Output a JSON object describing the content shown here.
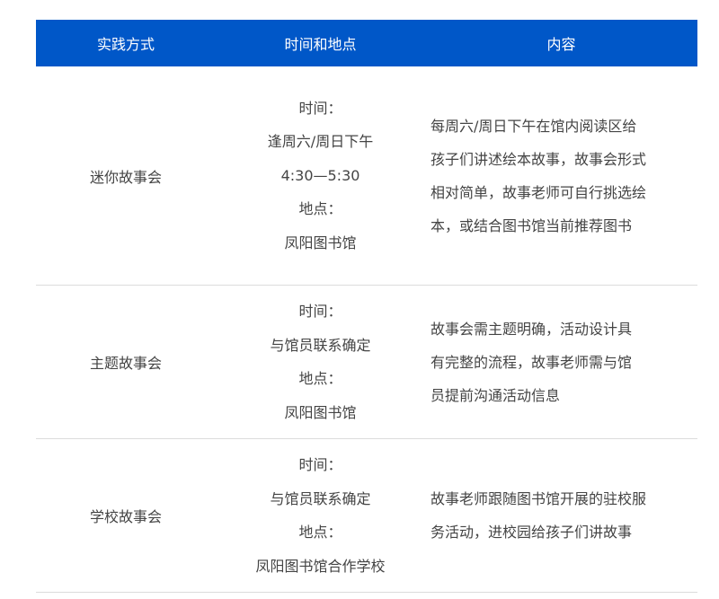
{
  "table": {
    "headers": [
      "实践方式",
      "时间和地点",
      "内容"
    ],
    "rows": [
      {
        "method": "迷你故事会",
        "time_label": "时间：",
        "time_value": [
          "逢周六/周日下午",
          "4:30—5:30"
        ],
        "place_label": "地点：",
        "place_value": "凤阳图书馆",
        "content_lines": [
          "每周六/周日下午在馆内阅读区给",
          "孩子们讲述绘本故事，故事会形式",
          "相对简单，故事老师可自行挑选绘",
          "本，或结合图书馆当前推荐图书"
        ]
      },
      {
        "method": "主题故事会",
        "time_label": "时间：",
        "time_value": [
          "与馆员联系确定"
        ],
        "place_label": "地点：",
        "place_value": "凤阳图书馆",
        "content_lines": [
          "故事会需主题明确，活动设计具",
          "有完整的流程，故事老师需与馆",
          "员提前沟通活动信息"
        ]
      },
      {
        "method": "学校故事会",
        "time_label": "时间：",
        "time_value": [
          "与馆员联系确定"
        ],
        "place_label": "地点：",
        "place_value": "凤阳图书馆合作学校",
        "content_lines": [
          "故事老师跟随图书馆开展的驻校服",
          "务活动，进校园给孩子们讲故事"
        ]
      }
    ]
  },
  "colors": {
    "header_bg": "#0057c8",
    "header_text": "#ffffff",
    "body_text": "#444444",
    "divider": "#dcdcdc"
  }
}
